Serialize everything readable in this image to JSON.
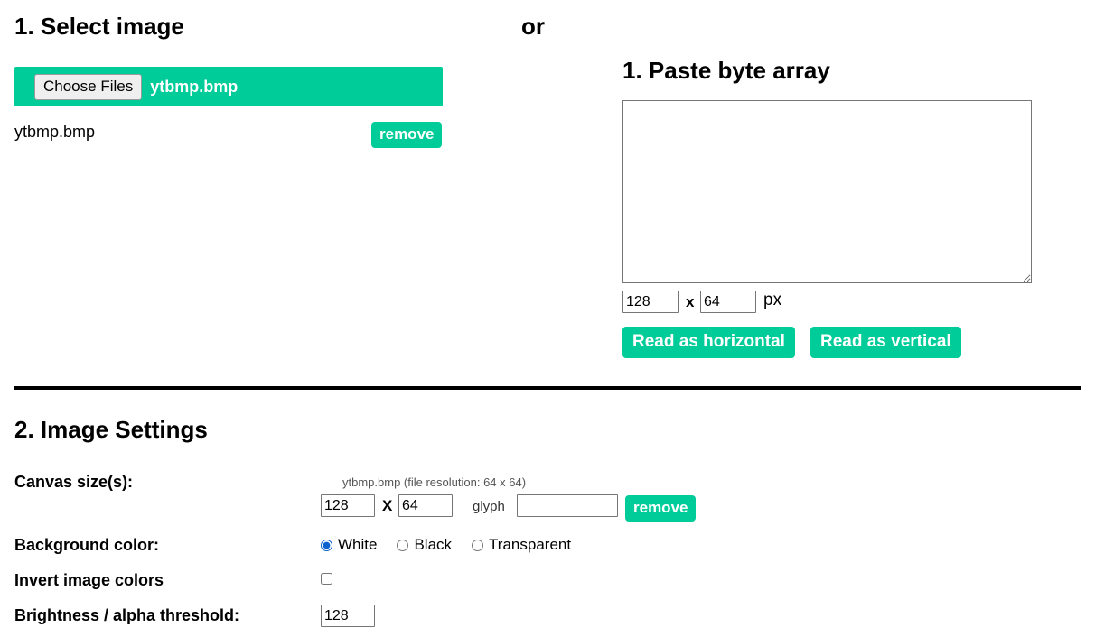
{
  "select_image": {
    "heading": "1. Select image",
    "choose_files_label": "Choose Files",
    "selected_file_inline": "ytbmp.bmp",
    "file_list": [
      {
        "name": "ytbmp.bmp",
        "remove_label": "remove"
      }
    ]
  },
  "or_separator": "or",
  "paste_byte_array": {
    "heading": "1. Paste byte array",
    "textarea_value": "",
    "textarea_placeholder": "",
    "width_value": "128",
    "x_separator": "x",
    "height_value": "64",
    "px_unit": "px",
    "read_horizontal_label": "Read as horizontal",
    "read_vertical_label": "Read as vertical"
  },
  "image_settings": {
    "heading": "2. Image Settings",
    "canvas_sizes": {
      "label": "Canvas size(s):",
      "file_info": "ytbmp.bmp  (file resolution: 64 x 64)",
      "width_value": "128",
      "x_separator": "X",
      "height_value": "64",
      "glyph_label": "glyph",
      "glyph_value": "",
      "remove_label": "remove"
    },
    "background_color": {
      "label": "Background color:",
      "selected": "White",
      "options": [
        {
          "label": "White",
          "checked": true
        },
        {
          "label": "Black",
          "checked": false
        },
        {
          "label": "Transparent",
          "checked": false
        }
      ]
    },
    "invert_image_colors": {
      "label": "Invert image colors",
      "checked": false
    },
    "brightness_threshold": {
      "label": "Brightness / alpha threshold:",
      "value": "128"
    }
  },
  "colors": {
    "accent_green": "#00cc99",
    "radio_blue": "#0b63ce",
    "text_black": "#000000",
    "muted_gray": "#555555",
    "input_border": "#767676"
  }
}
